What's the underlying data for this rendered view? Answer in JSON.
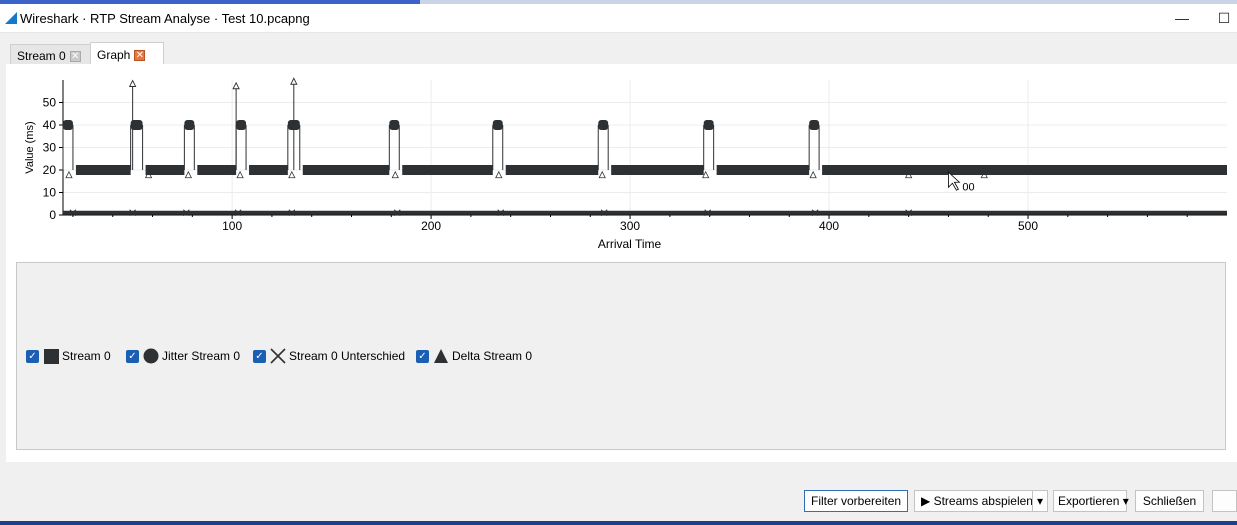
{
  "window": {
    "title": "Wireshark · RTP Stream Analyse · Test 10.pcapng",
    "minimize_glyph": "—",
    "maximize_glyph": "☐"
  },
  "tabs": [
    {
      "label": "Stream 0",
      "active": false,
      "close_glyph": "✕"
    },
    {
      "label": "Graph",
      "active": true,
      "close_glyph": "✕"
    }
  ],
  "chart_data": {
    "type": "scatter",
    "xlabel": "Arrival Time",
    "ylabel": "Value (ms)",
    "xlim": [
      15,
      600
    ],
    "ylim": [
      0,
      60
    ],
    "x_ticks": [
      "100",
      "200",
      "300",
      "400",
      "500"
    ],
    "y_ticks": [
      "0",
      "10",
      "20",
      "30",
      "40",
      "50"
    ],
    "cursor_label": "00",
    "series": [
      {
        "name": "Stream 0",
        "marker": "square",
        "color": "#2d3133",
        "baseline": 20,
        "spike_level": 40,
        "spike_intervals": [
          [
            15,
            20
          ],
          [
            49,
            55
          ],
          [
            76,
            81
          ],
          [
            102,
            107
          ],
          [
            128,
            134
          ],
          [
            179,
            184
          ],
          [
            231,
            236
          ],
          [
            284,
            289
          ],
          [
            337,
            342
          ],
          [
            390,
            395
          ]
        ]
      },
      {
        "name": "Jitter Stream 0",
        "marker": "circle",
        "color": "#2d3133",
        "baseline": 20
      },
      {
        "name": "Stream 0 Unterschied",
        "marker": "cross",
        "color": "#2d3133",
        "baseline": 1
      },
      {
        "name": "Delta Stream 0",
        "marker": "triangle",
        "color": "#2d3133",
        "peaks": [
          {
            "x": 50,
            "y": 58
          },
          {
            "x": 102,
            "y": 57
          },
          {
            "x": 131,
            "y": 59
          }
        ]
      }
    ]
  },
  "legend": [
    {
      "label": "Stream 0",
      "checked": true,
      "marker": "square-icon"
    },
    {
      "label": "Jitter Stream 0",
      "checked": true,
      "marker": "circle-icon"
    },
    {
      "label": "Stream 0 Unterschied",
      "checked": true,
      "marker": "cross-icon"
    },
    {
      "label": "Delta Stream 0",
      "checked": true,
      "marker": "triangle-icon"
    }
  ],
  "buttons": {
    "filter": "Filter vorbereiten",
    "play": "Streams abspielen",
    "export": "Exportieren",
    "close": "Schließen"
  }
}
